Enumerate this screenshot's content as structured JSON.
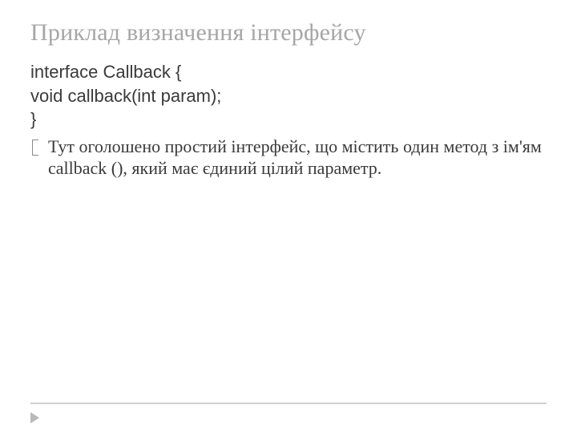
{
  "title": "Приклад визначення інтерфейсу",
  "code": {
    "line1": "interface Callback  {",
    "line2": "void callback(int param);",
    "line3": "}"
  },
  "bullet": {
    "text": "Тут оголошено простий інтерфейс, що містить один метод з ім'ям callback (), який має єдиний цілий параметр."
  }
}
